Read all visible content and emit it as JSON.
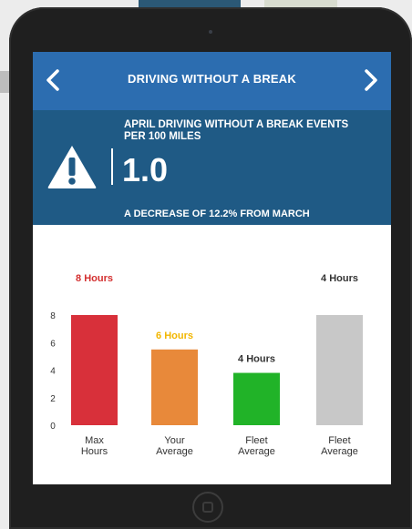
{
  "header": {
    "title": "DRIVING WITHOUT A BREAK",
    "prev_icon": "chevron-left-icon",
    "next_icon": "chevron-right-icon"
  },
  "stat": {
    "caption_line1": "APRIL DRIVING WITHOUT A BREAK EVENTS",
    "caption_line2": "PER 100 MILES",
    "value": "1.0",
    "subtext": "A DECREASE OF 12.2% FROM MARCH",
    "icon": "warning-icon"
  },
  "colors": {
    "topbar": "#2c6db0",
    "stat_panel": "#1f5a85"
  },
  "chart_data": {
    "type": "bar",
    "categories": [
      [
        "Max",
        "Hours"
      ],
      [
        "Your",
        "Average"
      ],
      [
        "Fleet",
        "Average"
      ],
      [
        "Fleet",
        "Average"
      ]
    ],
    "values": [
      8,
      5.5,
      3.8,
      8
    ],
    "data_labels": [
      "8 Hours",
      "6 Hours",
      "4 Hours",
      "4 Hours"
    ],
    "label_colors": [
      "#d32f2f",
      "#f2b600",
      "#333333",
      "#333333"
    ],
    "bar_colors": [
      "#d8303a",
      "#e8893a",
      "#21b328",
      "#c8c8c8"
    ],
    "yticks": [
      0,
      2,
      4,
      6,
      8
    ],
    "ylim": [
      0,
      8
    ],
    "grid": false
  }
}
